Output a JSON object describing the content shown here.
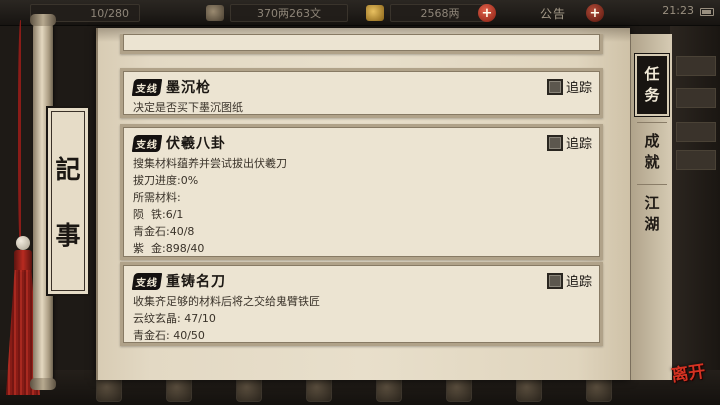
{
  "topbar": {
    "counter": "10/280",
    "money": "370两263文",
    "gold": "2568两",
    "announcement": "公告",
    "clock": "21:23"
  },
  "scroll": {
    "title_chars": [
      "記",
      "事"
    ]
  },
  "tabs": [
    {
      "label_chars": [
        "任",
        "务"
      ],
      "active": true
    },
    {
      "label_chars": [
        "成",
        "就"
      ],
      "active": false
    },
    {
      "label_chars": [
        "江",
        "湖"
      ],
      "active": false
    }
  ],
  "quests": [
    {
      "badge": "支线",
      "name": "墨沉枪",
      "track_label": "追踪",
      "lines": [
        "决定是否买下墨沉图纸"
      ]
    },
    {
      "badge": "支线",
      "name": "伏羲八卦",
      "track_label": "追踪",
      "lines": [
        "搜集材料蕴养并尝试拔出伏羲刀",
        "拔刀进度:0%",
        "所需材料:",
        "陨  铁:6/1",
        "青金石:40/8",
        "紫  金:898/40"
      ]
    },
    {
      "badge": "支线",
      "name": "重铸名刀",
      "track_label": "追踪",
      "lines": [
        "收集齐足够的材料后将之交给鬼臂铁匠",
        "云纹玄晶: 47/10",
        "青金石: 40/50"
      ]
    }
  ],
  "exit_label": "离开",
  "colors": {
    "accent_red": "#d43222",
    "paper": "#e8dfcb",
    "ink": "#1b1713"
  }
}
